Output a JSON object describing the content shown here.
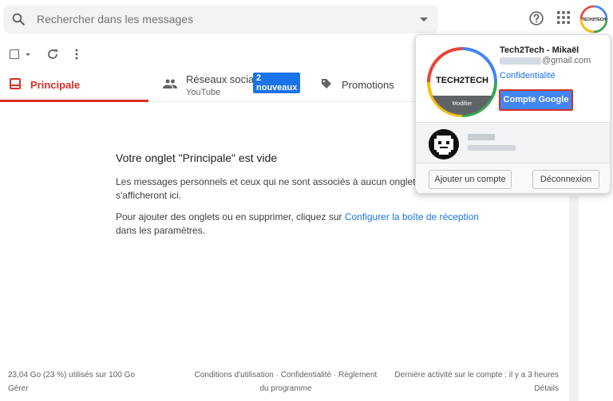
{
  "search": {
    "placeholder": "Rechercher dans les messages"
  },
  "header": {
    "icons": [
      "search-icon",
      "help-icon",
      "apps-grid-icon",
      "avatar"
    ]
  },
  "tabs": [
    {
      "label": "Principale",
      "active": true,
      "icon": "inbox-icon"
    },
    {
      "label": "Réseaux socia...",
      "sublabel": "YouTube",
      "badge": "2 nouveaux",
      "icon": "people-icon"
    },
    {
      "label": "Promotions",
      "icon": "tag-icon"
    }
  ],
  "empty": {
    "title": "Votre onglet \"Principale\" est vide",
    "line1": "Les messages personnels et ceux qui ne sont associés à aucun onglet en parti",
    "line1b": "s'afficheront ici.",
    "line2_pre": "Pour ajouter des onglets ou en supprimer, cliquez sur ",
    "line2_link": "Configurer la boîte de réception",
    "line2_post": "dans les paramètres."
  },
  "footer": {
    "storage": "23,04 Go (23 %) utilisés sur 100 Go",
    "manage": "Gérer",
    "terms": "Conditions d'utilisation · Confidentialité · Règlement",
    "terms2": "du programme",
    "activity": "Dernière activité sur le compte : il y a 3 heures",
    "details": "Détails"
  },
  "account": {
    "name": "Tech2Tech - Mikaël",
    "email_domain": "@gmail.com",
    "privacy": "Confidentialité",
    "google_account_button": "Compte Google",
    "avatar_text": "TECH2TECH",
    "avatar_modify": "Modifier",
    "add_account": "Ajouter un compte",
    "logout": "Déconnexion"
  },
  "colors": {
    "accent_red": "#d93025",
    "link_blue": "#1a73e8",
    "google_blue": "#4285f4"
  }
}
